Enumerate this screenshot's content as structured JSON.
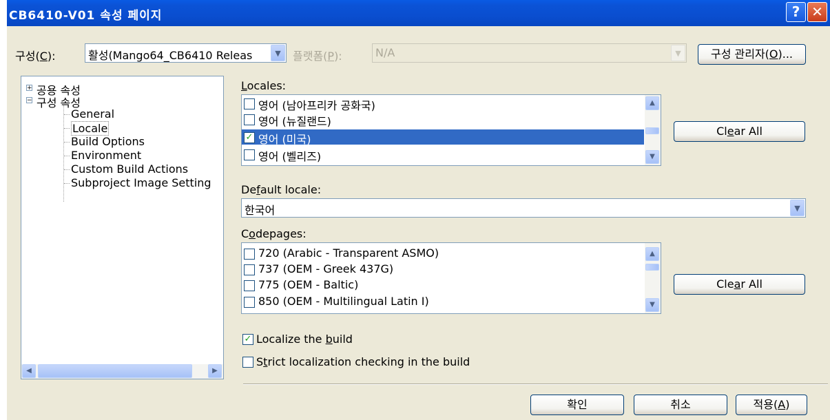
{
  "window": {
    "title": "CB6410-V01 속성 페이지",
    "help_glyph": "?",
    "close_glyph": "✕"
  },
  "config_row": {
    "config_label_pre": "구성(",
    "config_label_key": "C",
    "config_label_post": "):",
    "config_value": "활성(Mango64_CB6410 Releas",
    "platform_label_pre": "플랫폼(",
    "platform_label_key": "P",
    "platform_label_post": "):",
    "platform_value": "N/A",
    "manager_btn_pre": "구성 관리자(",
    "manager_btn_key": "O",
    "manager_btn_post": ")..."
  },
  "tree": {
    "items": [
      {
        "label": "공용 속성",
        "expander": "+"
      },
      {
        "label": "구성 속성",
        "expander": "−"
      },
      {
        "label": "General"
      },
      {
        "label": "Locale",
        "selected": true
      },
      {
        "label": "Build Options"
      },
      {
        "label": "Environment"
      },
      {
        "label": "Custom Build Actions"
      },
      {
        "label": "Subproject Image Setting"
      }
    ]
  },
  "locales": {
    "label_key": "L",
    "label_rest": "ocales:",
    "items": [
      {
        "label": "영어 (남아프리카 공화국)",
        "checked": false
      },
      {
        "label": "영어 (뉴질랜드)",
        "checked": false
      },
      {
        "label": "영어 (미국)",
        "checked": true,
        "selected": true
      },
      {
        "label": "영어 (벨리즈)",
        "checked": false
      }
    ],
    "clear_pre": "Cl",
    "clear_key": "e",
    "clear_post": "ar All"
  },
  "default_locale": {
    "label_pre": "De",
    "label_key": "f",
    "label_post": "ault locale:",
    "value": "한국어"
  },
  "codepages": {
    "label_pre": "C",
    "label_key": "o",
    "label_post": "depages:",
    "items": [
      {
        "label": "720  (Arabic - Transparent ASMO)",
        "checked": false
      },
      {
        "label": "737  (OEM - Greek 437G)",
        "checked": false
      },
      {
        "label": "775  (OEM - Baltic)",
        "checked": false
      },
      {
        "label": "850  (OEM - Multilingual Latin I)",
        "checked": false
      }
    ],
    "clear_pre": "Cle",
    "clear_key": "a",
    "clear_post": "r All"
  },
  "options": {
    "localize_pre": "Localize the ",
    "localize_key": "b",
    "localize_post": "uild",
    "localize_checked": true,
    "strict_pre": "S",
    "strict_key": "t",
    "strict_post": "rict localization checking in the build",
    "strict_checked": false
  },
  "footer": {
    "ok": "확인",
    "cancel": "취소",
    "apply_pre": "적용(",
    "apply_key": "A",
    "apply_post": ")"
  },
  "glyphs": {
    "check": "✓",
    "up": "▲",
    "down": "▼",
    "left": "◀",
    "right": "▶"
  }
}
